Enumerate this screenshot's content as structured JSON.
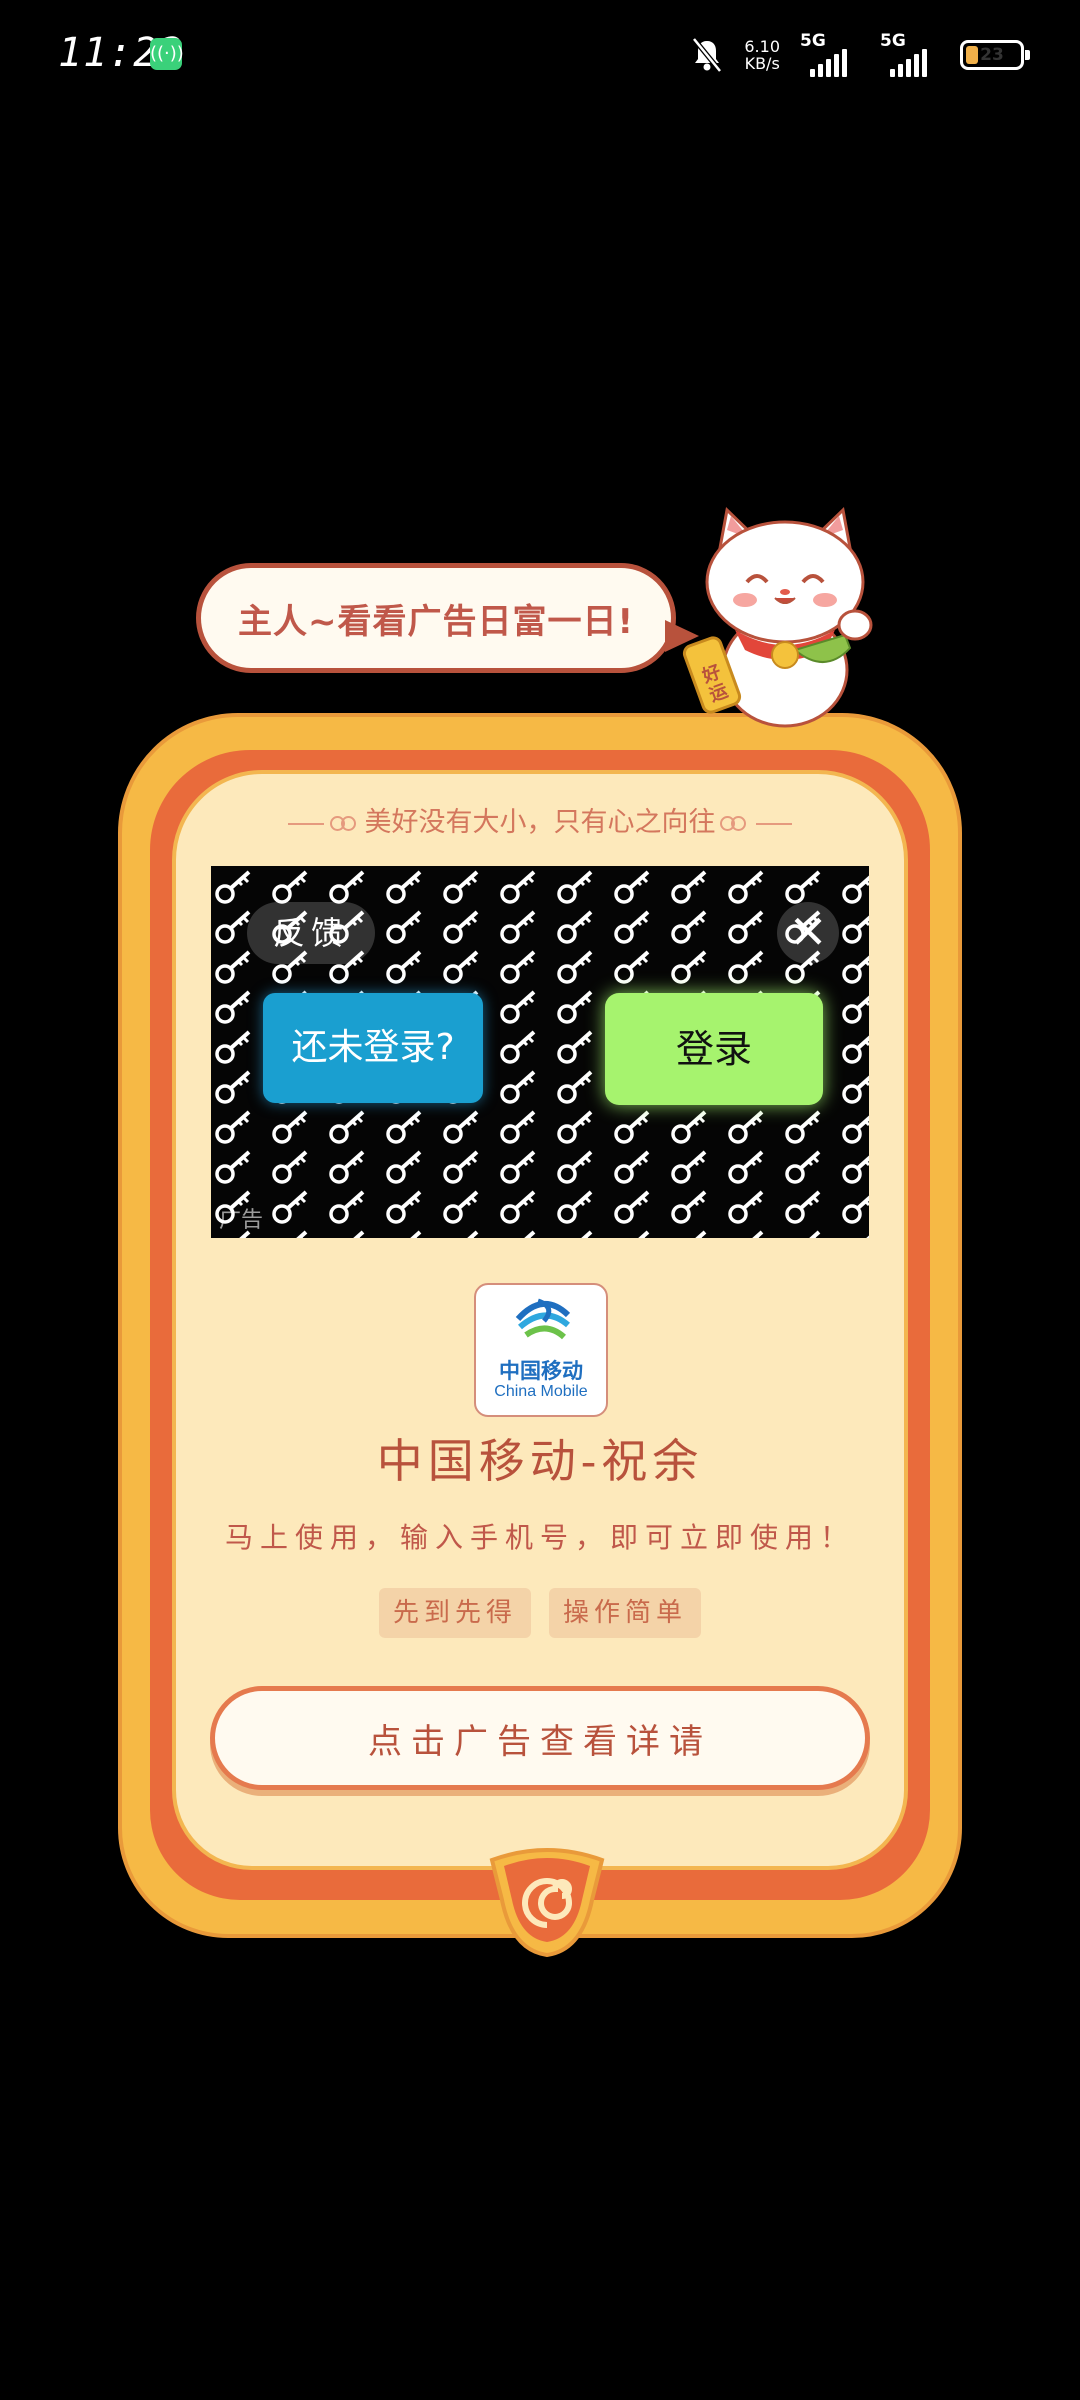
{
  "status_bar": {
    "time": "11:22",
    "net_speed_value": "6.10",
    "net_speed_unit": "KB/s",
    "sim1_label": "5G",
    "sim2_label": "5G",
    "battery_level": "23"
  },
  "ad": {
    "bubble_text": "主人~看看广告日富一日!",
    "motto": "美好没有大小，只有心之向往",
    "video": {
      "feedback_label": "反馈",
      "close_symbol": "✕",
      "not_logged_in_button": "还未登录?",
      "login_button": "登录",
      "ad_tag": "广告"
    },
    "app": {
      "logo_cn": "中国移动",
      "logo_en": "China Mobile",
      "name": "中国移动-祝余",
      "description": "马上使用，输入手机号，即可立即使用！",
      "tags": [
        "先到先得",
        "操作简单"
      ]
    },
    "cta_label": "点击广告查看详请"
  },
  "colors": {
    "frame_gold": "#f6b945",
    "frame_red": "#e96b3b",
    "frame_cream": "#fde9bb",
    "text_brown": "#b8523c",
    "login_green": "#a6f36e",
    "not_logged_blue": "#1a9fd0"
  }
}
